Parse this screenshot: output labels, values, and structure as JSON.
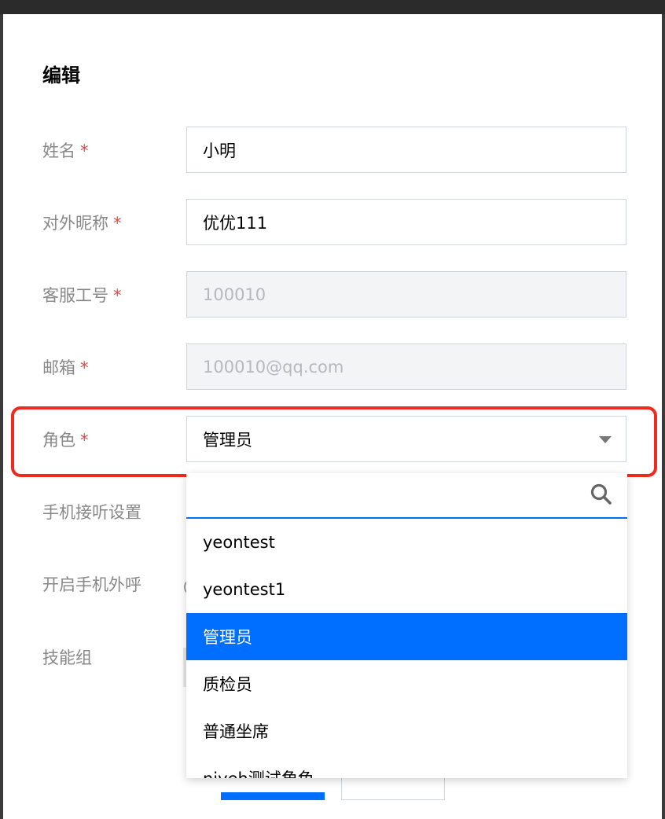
{
  "dialog": {
    "title": "编辑",
    "required_mark": "*"
  },
  "fields": {
    "name": {
      "label": "姓名",
      "value": "小明"
    },
    "nickname": {
      "label": "对外昵称",
      "value": "优优111"
    },
    "staff_id": {
      "label": "客服工号",
      "value": "100010"
    },
    "email": {
      "label": "邮箱",
      "value": "100010@qq.com"
    },
    "role": {
      "label": "角色",
      "value": "管理员"
    },
    "phone_answer": {
      "label": "手机接听设置"
    },
    "phone_outbound": {
      "label": "开启手机外呼"
    },
    "skill_group": {
      "label": "技能组"
    }
  },
  "role_dropdown": {
    "search_placeholder": "",
    "options": [
      "yeontest",
      "yeontest1",
      "管理员",
      "质检员",
      "普通坐席",
      "niyeh测试角色"
    ],
    "selected": "管理员"
  },
  "colors": {
    "accent": "#006eff",
    "required": "#e54545",
    "highlight": "#ef2a1e"
  }
}
